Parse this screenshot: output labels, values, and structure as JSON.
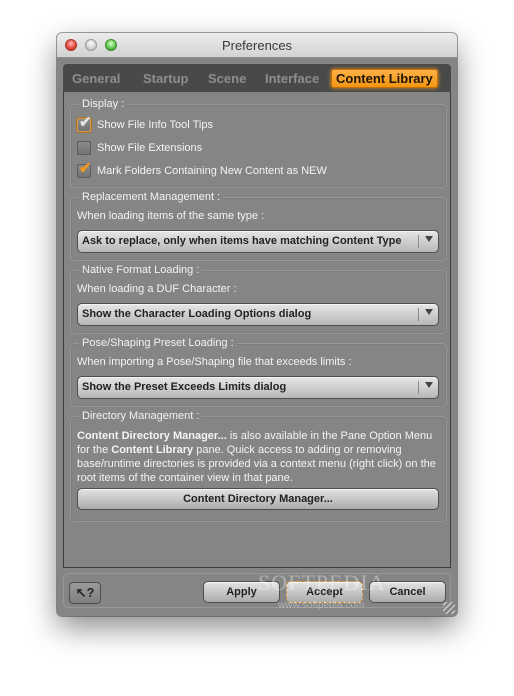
{
  "window": {
    "title": "Preferences"
  },
  "tabs": [
    {
      "label": "General",
      "active": false
    },
    {
      "label": "Startup",
      "active": false
    },
    {
      "label": "Scene",
      "active": false
    },
    {
      "label": "Interface",
      "active": false
    },
    {
      "label": "Content Library",
      "active": true
    }
  ],
  "display": {
    "label": "Display :",
    "checkboxes": [
      {
        "label": "Show File Info Tool Tips",
        "checked": true,
        "focused": true
      },
      {
        "label": "Show File Extensions",
        "checked": false
      },
      {
        "label": "Mark Folders Containing New Content as NEW",
        "checked": true
      }
    ]
  },
  "replacement": {
    "label": "Replacement Management :",
    "prompt": "When loading items of the same type :",
    "selected": "Ask to replace, only when items have matching Content Type"
  },
  "native_format": {
    "label": "Native Format Loading :",
    "prompt": "When loading a DUF Character :",
    "selected": "Show the Character Loading Options dialog"
  },
  "pose_preset": {
    "label": "Pose/Shaping Preset Loading :",
    "prompt": "When importing a Pose/Shaping file that exceeds limits :",
    "selected": "Show the Preset Exceeds Limits dialog"
  },
  "directory": {
    "label": "Directory Management :",
    "desc_bold_1": "Content Directory Manager...",
    "desc_1": " is also available in the Pane Option Menu for the ",
    "desc_bold_2": "Content Library",
    "desc_2": " pane. Quick access to adding or removing base/runtime directories is provided via a context menu (right click) on the root items of the container view in that pane.",
    "button_label": "Content Directory Manager..."
  },
  "footer": {
    "help_label": "↖?",
    "apply_label": "Apply",
    "accept_label": "Accept",
    "cancel_label": "Cancel"
  },
  "watermark": {
    "brand": "SOFTPEDIA",
    "url": "www.softpedia.com"
  },
  "icons": {
    "check": "✔",
    "dropdown": "chevron-down-icon"
  },
  "colors": {
    "accent": "#f19410",
    "panel": "#858585",
    "tabbar": "#494949"
  }
}
